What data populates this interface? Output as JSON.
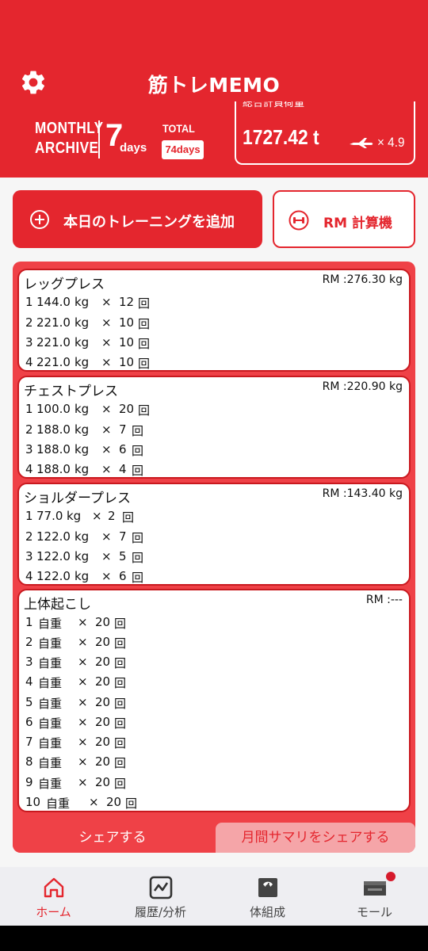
{
  "header": {
    "title": "筋トレMEMO",
    "monthly_line1": "MONTHLY",
    "monthly_line2": "ARCHIVE",
    "monthly_days": "7",
    "monthly_days_unit": "days",
    "total_label": "TOTAL",
    "total_days": "74days",
    "stat_label": "総合計負荷量",
    "stat_value": "1727.42 t",
    "stat_multiplier": "× 4.9",
    "stat_icon": "airplane-icon",
    "settings_icon": "gear-icon"
  },
  "actions": {
    "add_training": "本日のトレーニングを追加",
    "rm_calculator": "RM 計算機"
  },
  "exercises": [
    {
      "name": "レッグプレス",
      "rm": "RM :276.30 kg",
      "sets": [
        {
          "no": "1",
          "weight": "144.0",
          "unit": "kg",
          "x": "×",
          "reps": "12",
          "rep_unit": "回"
        },
        {
          "no": "2",
          "weight": "221.0",
          "unit": "kg",
          "x": "×",
          "reps": "10",
          "rep_unit": "回"
        },
        {
          "no": "3",
          "weight": "221.0",
          "unit": "kg",
          "x": "×",
          "reps": "10",
          "rep_unit": "回"
        },
        {
          "no": "4",
          "weight": "221.0",
          "unit": "kg",
          "x": "×",
          "reps": "10",
          "rep_unit": "回"
        }
      ]
    },
    {
      "name": "チェストプレス",
      "rm": "RM :220.90 kg",
      "sets": [
        {
          "no": "1",
          "weight": "100.0",
          "unit": "kg",
          "x": "×",
          "reps": "20",
          "rep_unit": "回"
        },
        {
          "no": "2",
          "weight": "188.0",
          "unit": "kg",
          "x": "×",
          "reps": "7",
          "rep_unit": "回"
        },
        {
          "no": "3",
          "weight": "188.0",
          "unit": "kg",
          "x": "×",
          "reps": "6",
          "rep_unit": "回"
        },
        {
          "no": "4",
          "weight": "188.0",
          "unit": "kg",
          "x": "×",
          "reps": "4",
          "rep_unit": "回"
        }
      ]
    },
    {
      "name": "ショルダープレス",
      "rm": "RM :143.40 kg",
      "sets": [
        {
          "no": "1",
          "weight": "77.0",
          "unit": "kg",
          "x": "×",
          "reps": "2",
          "rep_unit": "回"
        },
        {
          "no": "2",
          "weight": "122.0",
          "unit": "kg",
          "x": "×",
          "reps": "7",
          "rep_unit": "回"
        },
        {
          "no": "3",
          "weight": "122.0",
          "unit": "kg",
          "x": "×",
          "reps": "5",
          "rep_unit": "回"
        },
        {
          "no": "4",
          "weight": "122.0",
          "unit": "kg",
          "x": "×",
          "reps": "6",
          "rep_unit": "回"
        }
      ]
    },
    {
      "name": "上体起こし",
      "rm": "RM :---",
      "sets": [
        {
          "no": "1",
          "weight": "自重",
          "x": "×",
          "reps": "20",
          "rep_unit": "回"
        },
        {
          "no": "2",
          "weight": "自重",
          "x": "×",
          "reps": "20",
          "rep_unit": "回"
        },
        {
          "no": "3",
          "weight": "自重",
          "x": "×",
          "reps": "20",
          "rep_unit": "回"
        },
        {
          "no": "4",
          "weight": "自重",
          "x": "×",
          "reps": "20",
          "rep_unit": "回"
        },
        {
          "no": "5",
          "weight": "自重",
          "x": "×",
          "reps": "20",
          "rep_unit": "回"
        },
        {
          "no": "6",
          "weight": "自重",
          "x": "×",
          "reps": "20",
          "rep_unit": "回"
        },
        {
          "no": "7",
          "weight": "自重",
          "x": "×",
          "reps": "20",
          "rep_unit": "回"
        },
        {
          "no": "8",
          "weight": "自重",
          "x": "×",
          "reps": "20",
          "rep_unit": "回"
        },
        {
          "no": "9",
          "weight": "自重",
          "x": "×",
          "reps": "20",
          "rep_unit": "回"
        },
        {
          "no": "10",
          "weight": "自重",
          "x": "×",
          "reps": "20",
          "rep_unit": "回"
        }
      ]
    }
  ],
  "share": {
    "share_label": "シェアする",
    "share_month_label": "月間サマリをシェアする"
  },
  "nav": [
    {
      "label": "ホーム",
      "icon": "home-icon",
      "active": true
    },
    {
      "label": "履歴/分析",
      "icon": "chart-icon",
      "active": false
    },
    {
      "label": "体組成",
      "icon": "scale-icon",
      "active": false
    },
    {
      "label": "モール",
      "icon": "shop-icon",
      "active": false
    }
  ],
  "colors": {
    "brand_red": "#e4262e",
    "panel_red": "#ef4147",
    "nav_bg": "#eeeef2"
  }
}
